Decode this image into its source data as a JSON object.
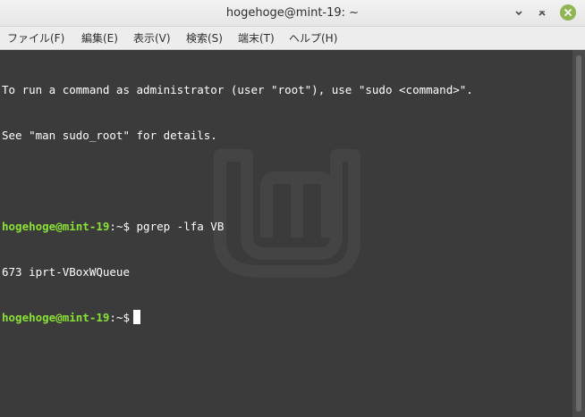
{
  "window": {
    "title": "hogehoge@mint-19: ~",
    "minimize_glyph": "‸",
    "maximize_glyph": "˄",
    "close_glyph": "✕"
  },
  "menu": {
    "items": [
      {
        "label": "ファイル(F)"
      },
      {
        "label": "編集(E)"
      },
      {
        "label": "表示(V)"
      },
      {
        "label": "検索(S)"
      },
      {
        "label": "端末(T)"
      },
      {
        "label": "ヘルプ(H)"
      }
    ]
  },
  "terminal": {
    "info_line_1": "To run a command as administrator (user \"root\"), use \"sudo <command>\".",
    "info_line_2": "See \"man sudo_root\" for details.",
    "prompt_user": "hogehoge@mint-19",
    "prompt_path": ":~$",
    "command_1": " pgrep -lfa VB",
    "output_1": "673 iprt-VBoxWQueue",
    "colors": {
      "background": "#3b3b3b",
      "prompt_user": "#8ae234",
      "text": "#ffffff"
    }
  },
  "icons": {
    "logo": "linux-mint-logo-icon",
    "close": "close-icon",
    "minimize": "minimize-icon",
    "maximize": "maximize-icon"
  }
}
